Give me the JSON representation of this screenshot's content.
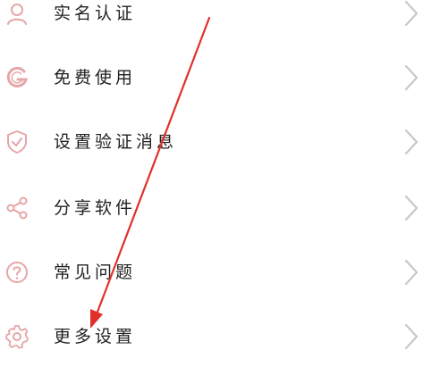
{
  "menu": {
    "items": [
      {
        "label": "实名认证",
        "icon": "person-icon"
      },
      {
        "label": "免费使用",
        "icon": "g-logo-icon"
      },
      {
        "label": "设置验证消息",
        "icon": "shield-check-icon"
      },
      {
        "label": "分享软件",
        "icon": "share-icon"
      },
      {
        "label": "常见问题",
        "icon": "question-icon"
      },
      {
        "label": "更多设置",
        "icon": "gear-icon"
      }
    ]
  },
  "colors": {
    "icon": "#e6a6a8",
    "text": "#222222",
    "chevron": "#c8c8c8",
    "annotation": "#e0302a"
  }
}
